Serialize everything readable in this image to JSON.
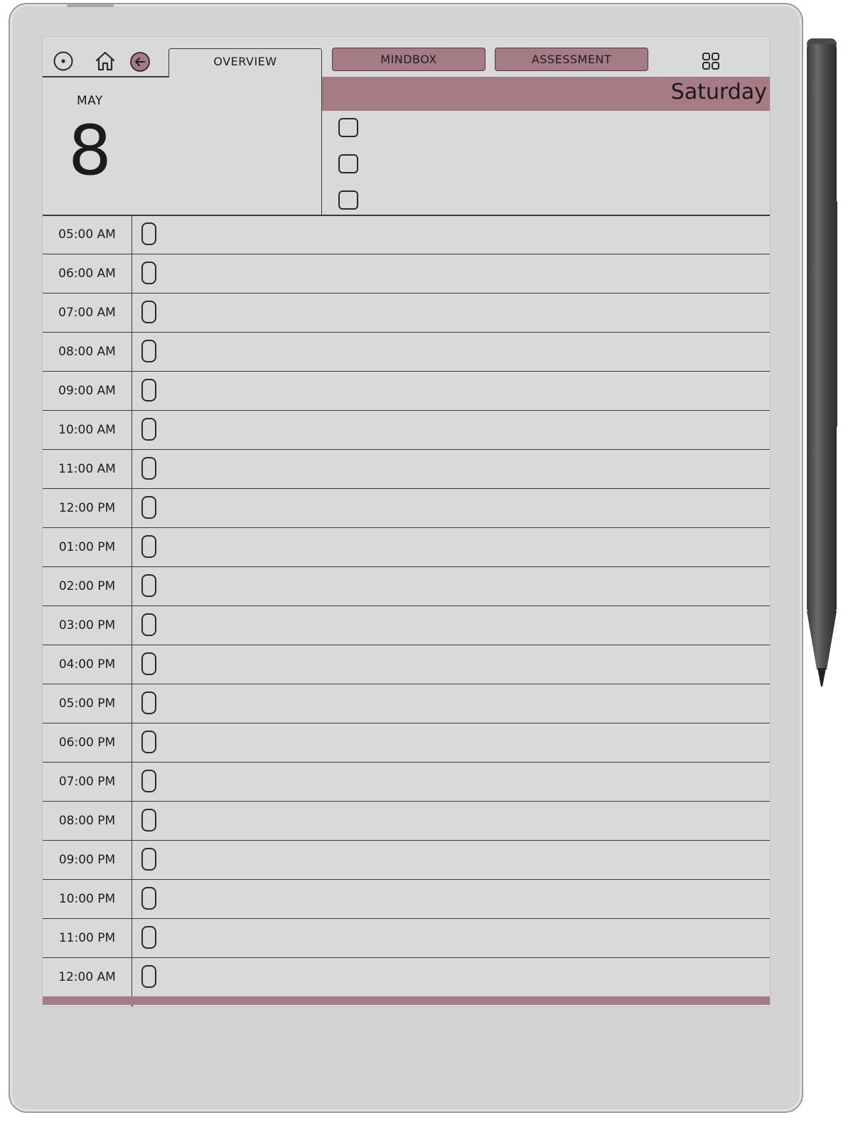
{
  "header": {
    "tabs": [
      {
        "label": "OVERVIEW",
        "active": true
      },
      {
        "label": "MINDBOX",
        "active": false
      },
      {
        "label": "ASSESSMENT",
        "active": false
      }
    ],
    "icons": [
      "status-circle-icon",
      "home-icon",
      "back-arrow-icon",
      "grid-icon"
    ]
  },
  "date": {
    "month": "MAY",
    "day": "8",
    "weekday": "Saturday"
  },
  "tasks": [
    {
      "done": false
    },
    {
      "done": false
    },
    {
      "done": false
    }
  ],
  "schedule": [
    {
      "time": "05:00 AM"
    },
    {
      "time": "06:00 AM"
    },
    {
      "time": "07:00 AM"
    },
    {
      "time": "08:00 AM"
    },
    {
      "time": "09:00 AM"
    },
    {
      "time": "10:00 AM"
    },
    {
      "time": "11:00 AM"
    },
    {
      "time": "12:00 PM"
    },
    {
      "time": "01:00 PM"
    },
    {
      "time": "02:00 PM"
    },
    {
      "time": "03:00 PM"
    },
    {
      "time": "04:00 PM"
    },
    {
      "time": "05:00 PM"
    },
    {
      "time": "06:00 PM"
    },
    {
      "time": "07:00 PM"
    },
    {
      "time": "08:00 PM"
    },
    {
      "time": "09:00 PM"
    },
    {
      "time": "10:00 PM"
    },
    {
      "time": "11:00 PM"
    },
    {
      "time": "12:00 AM"
    }
  ],
  "colors": {
    "accent": "#a57c85",
    "screen": "#d9d9d9",
    "ink": "#1b1b1b"
  }
}
